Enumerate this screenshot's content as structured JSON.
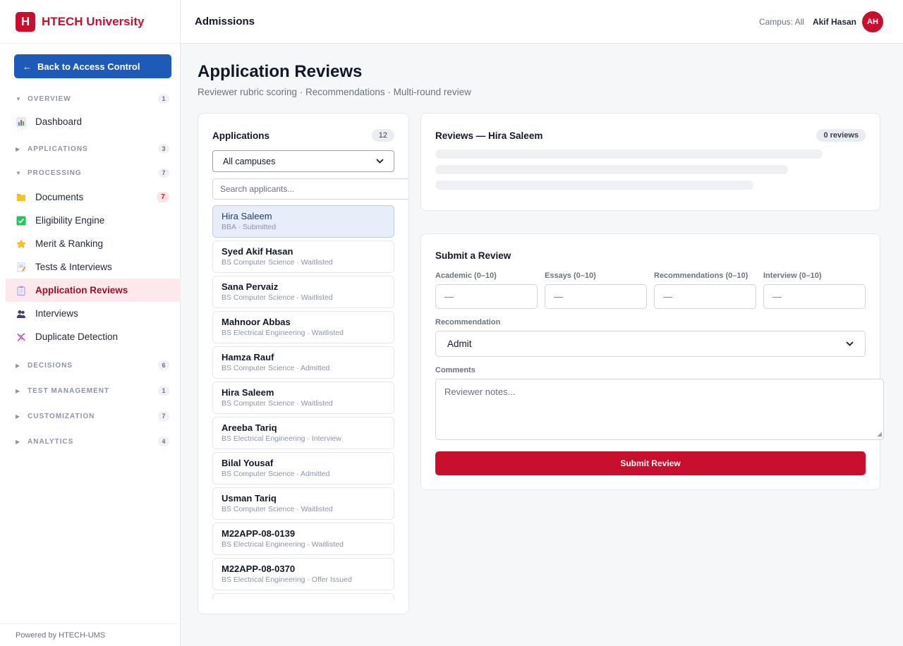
{
  "brand": {
    "logo_letter": "H",
    "name": "HTECH University"
  },
  "sidebar": {
    "back_label": "Back to Access Control",
    "back_arrow": "←",
    "sections": {
      "overview": {
        "label": "OVERVIEW",
        "count": "1"
      },
      "applications": {
        "label": "APPLICATIONS",
        "count": "3"
      },
      "processing": {
        "label": "PROCESSING",
        "count": "7"
      },
      "decisions": {
        "label": "DECISIONS",
        "count": "6"
      },
      "test_management": {
        "label": "TEST MANAGEMENT",
        "count": "1"
      },
      "customization": {
        "label": "CUSTOMIZATION",
        "count": "7"
      },
      "analytics": {
        "label": "ANALYTICS",
        "count": "4"
      }
    },
    "items": {
      "dashboard": "Dashboard",
      "documents": "Documents",
      "documents_count": "7",
      "eligibility": "Eligibility Engine",
      "merit": "Merit & Ranking",
      "tests": "Tests & Interviews",
      "reviews": "Application Reviews",
      "interviews": "Interviews",
      "duplicates": "Duplicate Detection"
    },
    "footer": "Powered by HTECH-UMS"
  },
  "topbar": {
    "title": "Admissions",
    "campus": "Campus: All",
    "user_name": "Akif Hasan",
    "avatar_initials": "AH"
  },
  "page": {
    "title": "Application Reviews",
    "subtitle": "Reviewer rubric scoring · Recommendations · Multi-round review"
  },
  "applications": {
    "title": "Applications",
    "count": "12",
    "campus_filter": "All campuses",
    "search_placeholder": "Search applicants...",
    "list": [
      {
        "name": "Hira Saleem",
        "meta": "BBA · Submitted"
      },
      {
        "name": "Syed Akif Hasan",
        "meta": "BS Computer Science · Waitlisted"
      },
      {
        "name": "Sana Pervaiz",
        "meta": "BS Computer Science · Waitlisted"
      },
      {
        "name": "Mahnoor Abbas",
        "meta": "BS Electrical Engineering · Waitlisted"
      },
      {
        "name": "Hamza Rauf",
        "meta": "BS Computer Science · Admitted"
      },
      {
        "name": "Hira Saleem",
        "meta": "BS Computer Science · Waitlisted"
      },
      {
        "name": "Areeba Tariq",
        "meta": "BS Electrical Engineering · Interview"
      },
      {
        "name": "Bilal Yousaf",
        "meta": "BS Computer Science · Admitted"
      },
      {
        "name": "Usman Tariq",
        "meta": "BS Computer Science · Waitlisted"
      },
      {
        "name": "M22APP-08-0139",
        "meta": "BS Electrical Engineering · Waitlisted"
      },
      {
        "name": "M22APP-08-0370",
        "meta": "BS Electrical Engineering · Offer Issued"
      }
    ]
  },
  "reviews": {
    "title": "Reviews — Hira Saleem",
    "count_badge": "0 reviews"
  },
  "submit_review": {
    "title": "Submit a Review",
    "academic_label": "Academic (0–10)",
    "essays_label": "Essays (0–10)",
    "recommendations_label": "Recommendations (0–10)",
    "interview_label": "Interview (0–10)",
    "score_placeholder": "—",
    "recommendation_label": "Recommendation",
    "recommendation_value": "Admit",
    "comments_label": "Comments",
    "comments_placeholder": "Reviewer notes...",
    "submit_label": "Submit Review"
  },
  "colors": {
    "brand_red": "#c8102e",
    "back_button_blue": "#1e5bb8",
    "active_bg": "#fde8ec"
  },
  "icons": {
    "dashboard": "bar-chart-icon",
    "documents": "folder-icon",
    "eligibility": "check-box-icon",
    "merit": "star-icon",
    "tests": "memo-icon",
    "reviews": "clipboard-icon",
    "interviews": "people-icon",
    "duplicates": "dna-icon"
  }
}
